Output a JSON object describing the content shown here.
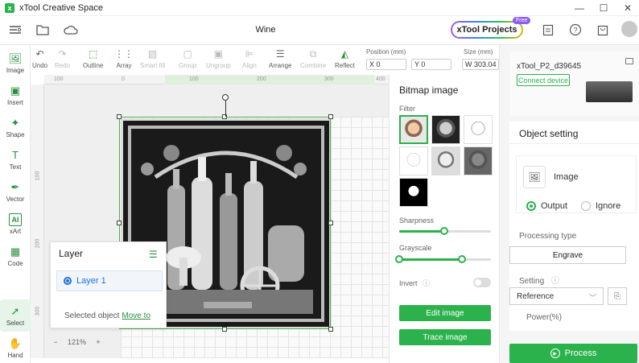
{
  "app": {
    "title": "xTool Creative Space",
    "document_title": "Wine"
  },
  "window_controls": {
    "minimize": "—",
    "maximize": "☐",
    "close": "✕"
  },
  "header": {
    "xtool_projects_label": "xTool Projects",
    "free_badge": "Free",
    "icons": [
      "menu-icon",
      "folder-icon",
      "cloud-icon",
      "clipboard-icon",
      "help-icon",
      "shop-icon",
      "avatar"
    ]
  },
  "left_tools": [
    {
      "name": "image",
      "label": "Image",
      "icon": "🖼"
    },
    {
      "name": "insert",
      "label": "Insert",
      "icon": "▣"
    },
    {
      "name": "shape",
      "label": "Shape",
      "icon": "✦"
    },
    {
      "name": "text",
      "label": "Text",
      "icon": "T"
    },
    {
      "name": "vector",
      "label": "Vector",
      "icon": "✒"
    },
    {
      "name": "xart",
      "label": "xArt",
      "icon": "AI"
    },
    {
      "name": "code",
      "label": "Code",
      "icon": "▦"
    },
    {
      "name": "select",
      "label": "Select",
      "icon": "➚"
    },
    {
      "name": "hand",
      "label": "Hand",
      "icon": "✋"
    }
  ],
  "edit_tools": [
    {
      "name": "undo",
      "label": "Undo",
      "icon": "↶",
      "enabled": true
    },
    {
      "name": "redo",
      "label": "Redo",
      "icon": "↷",
      "enabled": false
    },
    {
      "name": "outline",
      "label": "Outline",
      "icon": "⬚",
      "enabled": true
    },
    {
      "name": "array",
      "label": "Array",
      "icon": "⋮⋮",
      "enabled": true
    },
    {
      "name": "smart-fill",
      "label": "Smart fill",
      "icon": "▧",
      "enabled": false
    },
    {
      "name": "group",
      "label": "Group",
      "icon": "▢",
      "enabled": false
    },
    {
      "name": "ungroup",
      "label": "Ungroup",
      "icon": "▣",
      "enabled": false
    },
    {
      "name": "align",
      "label": "Align",
      "icon": "⊫",
      "enabled": false
    },
    {
      "name": "arrange",
      "label": "Arrange",
      "icon": "☰",
      "enabled": true
    },
    {
      "name": "combine",
      "label": "Combine",
      "icon": "⧉",
      "enabled": false
    },
    {
      "name": "reflect",
      "label": "Reflect",
      "icon": "◭",
      "enabled": true
    }
  ],
  "position": {
    "label": "Position (mm)",
    "x": "X 0",
    "y": "Y 0"
  },
  "size": {
    "label": "Size (mm)",
    "w": "W 303.04"
  },
  "rulers": {
    "top": [
      "100",
      "0",
      "100",
      "200",
      "300",
      "400"
    ],
    "left": [
      "100",
      "200",
      "300"
    ]
  },
  "zoom": {
    "minus": "−",
    "value": "121%",
    "plus": "+"
  },
  "layer_panel": {
    "title": "Layer",
    "layer_name": "Layer 1",
    "selected_object_text": "Selected object",
    "move_to": "Move to"
  },
  "bitmap_panel": {
    "title": "Bitmap image",
    "filter_label": "Filter",
    "sharpness_label": "Sharpness",
    "sharpness_value": 0.49,
    "grayscale_label": "Grayscale",
    "grayscale_low": 0.0,
    "grayscale_high": 0.68,
    "invert_label": "Invert",
    "invert_on": false,
    "edit_image": "Edit image",
    "trace_image": "Trace image"
  },
  "device": {
    "name": "xTool_P2_d39645",
    "connect": "Connect device"
  },
  "object_setting": {
    "title": "Object setting",
    "image_label": "Image",
    "output": "Output",
    "ignore": "Ignore",
    "processing_type_label": "Processing type",
    "processing_type": "Engrave",
    "setting_label": "Setting",
    "setting_value": "Reference",
    "power_label": "Power(%)"
  },
  "process_button": "Process",
  "colors": {
    "accent": "#2bb24c",
    "layer_blue": "#1f6fe0"
  }
}
